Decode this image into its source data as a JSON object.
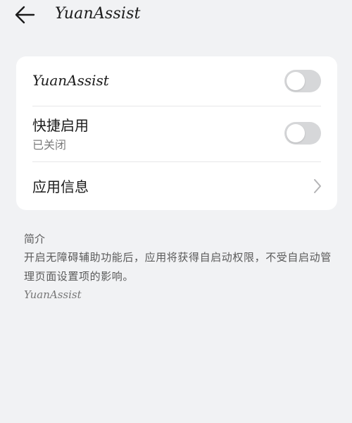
{
  "header": {
    "back_icon": "back-arrow-icon",
    "title": "YuanAssist"
  },
  "settings": {
    "items": [
      {
        "label": "YuanAssist",
        "control": "toggle",
        "enabled": false
      },
      {
        "label": "快捷启用",
        "sublabel": "已关闭",
        "control": "toggle",
        "enabled": false
      },
      {
        "label": "应用信息",
        "control": "chevron-right-icon"
      }
    ]
  },
  "about": {
    "title": "简介",
    "description": "开启无障碍辅助功能后，应用将获得自启动权限，不受自启动管理页面设置项的影响。",
    "footer": "YuanAssist"
  },
  "colors": {
    "background": "#f1f2f4",
    "card": "#ffffff",
    "toggle_off": "#d6d7d9"
  }
}
